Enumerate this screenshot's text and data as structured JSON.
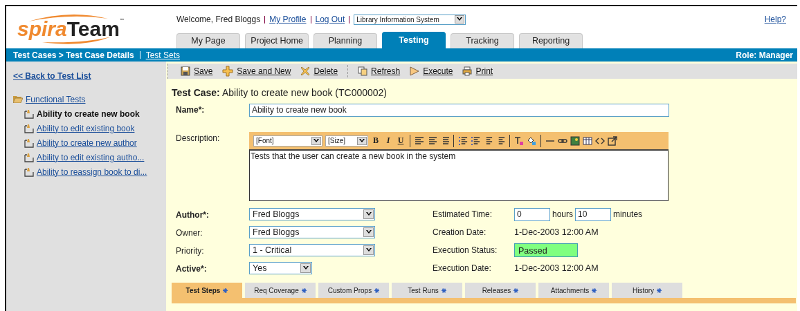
{
  "logo": {
    "part1": "spira",
    "part2": "Team",
    "mark": "™"
  },
  "header": {
    "welcome": "Welcome, Fred Bloggs",
    "links": [
      "My Profile",
      "Log Out"
    ],
    "project": "Library Information System",
    "help": "Help?"
  },
  "tabs": [
    {
      "label": "My Page",
      "selected": false
    },
    {
      "label": "Project Home",
      "selected": false
    },
    {
      "label": "Planning",
      "selected": false
    },
    {
      "label": "Testing",
      "selected": true
    },
    {
      "label": "Tracking",
      "selected": false
    },
    {
      "label": "Reporting",
      "selected": false
    }
  ],
  "breadcrumb": {
    "path": "Test Cases > Test Case Details",
    "link": "Test Sets",
    "role": "Role: Manager"
  },
  "sidebar": {
    "back": "<< Back to Test List",
    "folder": "Functional Tests",
    "items": [
      {
        "label": "Ability to create new book",
        "selected": true
      },
      {
        "label": "Ability to edit existing book",
        "selected": false
      },
      {
        "label": "Ability to create new author",
        "selected": false
      },
      {
        "label": "Ability to edit existing autho...",
        "selected": false
      },
      {
        "label": "Ability to reassign book to di...",
        "selected": false
      }
    ]
  },
  "toolbar": [
    {
      "label": "Save",
      "kind": "save"
    },
    {
      "label": "Save and New",
      "kind": "new"
    },
    {
      "label": "Delete",
      "kind": "delete"
    },
    {
      "label": "Refresh",
      "kind": "refresh"
    },
    {
      "label": "Execute",
      "kind": "execute"
    },
    {
      "label": "Print",
      "kind": "print"
    }
  ],
  "title": {
    "prefix": "Test Case:",
    "text": "Ability to create new book (TC000002)"
  },
  "name": {
    "label": "Name*:",
    "required": true,
    "value": "Ability to create new book"
  },
  "description": {
    "label": "Description:",
    "font": "[Font]",
    "size": "[Size]",
    "bold": "B",
    "italic": "I",
    "underline": "U",
    "value": "Tests that the user can create a new book in the system"
  },
  "left_fields": [
    {
      "label": "Author*:",
      "required": true,
      "value": "Fred Bloggs",
      "kind": "wide"
    },
    {
      "label": "Owner:",
      "required": false,
      "value": "Fred Bloggs",
      "kind": "wide"
    },
    {
      "label": "Priority:",
      "required": false,
      "value": "1 - Critical",
      "kind": "wide"
    },
    {
      "label": "Active*:",
      "required": true,
      "value": "Yes",
      "kind": "narrow"
    }
  ],
  "estimated_time": {
    "label": "Estimated Time:",
    "hours": "0",
    "hours_unit": "hours",
    "minutes": "10",
    "minutes_unit": "minutes"
  },
  "right_fields": [
    {
      "label": "Creation Date:",
      "value": "1-Dec-2003 12:00 AM",
      "kind": "text"
    },
    {
      "label": "Execution Status:",
      "value": "Passed",
      "kind": "status"
    },
    {
      "label": "Execution Date:",
      "value": "1-Dec-2003 12:00 AM",
      "kind": "text"
    }
  ],
  "detail_tabs": [
    {
      "label": "Test Steps",
      "selected": true
    },
    {
      "label": "Req Coverage",
      "selected": false
    },
    {
      "label": "Custom Props",
      "selected": false
    },
    {
      "label": "Test Runs",
      "selected": false
    },
    {
      "label": "Releases",
      "selected": false
    },
    {
      "label": "Attachments",
      "selected": false
    },
    {
      "label": "History",
      "selected": false
    }
  ]
}
